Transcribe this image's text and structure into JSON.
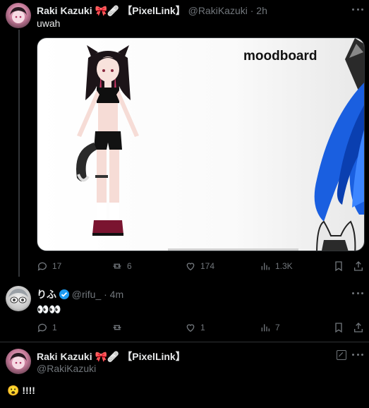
{
  "tweet1": {
    "author_name": "Raki Kazuki",
    "author_tag": "【PixelLink】",
    "handle": "@RakiKazuki",
    "time": "· 2h",
    "text": "uwah",
    "image_title": "moodboard",
    "actions": {
      "replies": "17",
      "retweets": "6",
      "likes": "174",
      "views": "1.3K"
    }
  },
  "tweet2": {
    "author_name": "りふ",
    "handle": "@rifu_",
    "time": "· 4m",
    "text": "👀👀",
    "actions": {
      "replies": "1",
      "retweets": "",
      "likes": "1",
      "views": "7"
    }
  },
  "tweet3": {
    "author_name": "Raki Kazuki",
    "author_tag": "【PixelLink】",
    "handle": "@RakiKazuki",
    "text": "😮 !!!!"
  },
  "colors": {
    "background": "#000000",
    "text": "#e7e9ea",
    "muted": "#71767b",
    "verified": "#1d9bf0",
    "divider": "#2f3336"
  }
}
